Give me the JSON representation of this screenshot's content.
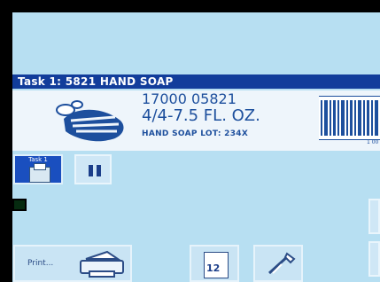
{
  "task_title": "Task 1: 5821 HAND SOAP",
  "label": {
    "code": "17000 05821",
    "size": "4/4-7.5 FL. OZ.",
    "desc": "HAND SOAP   LOT: 234X"
  },
  "buttons": {
    "task": "Task 1",
    "print": "Print..."
  },
  "calc_icon_text": "12",
  "colors": {
    "screen_bg": "#b7dff2",
    "title_bar": "#123d9b",
    "accent_blue": "#1a4fbf"
  }
}
